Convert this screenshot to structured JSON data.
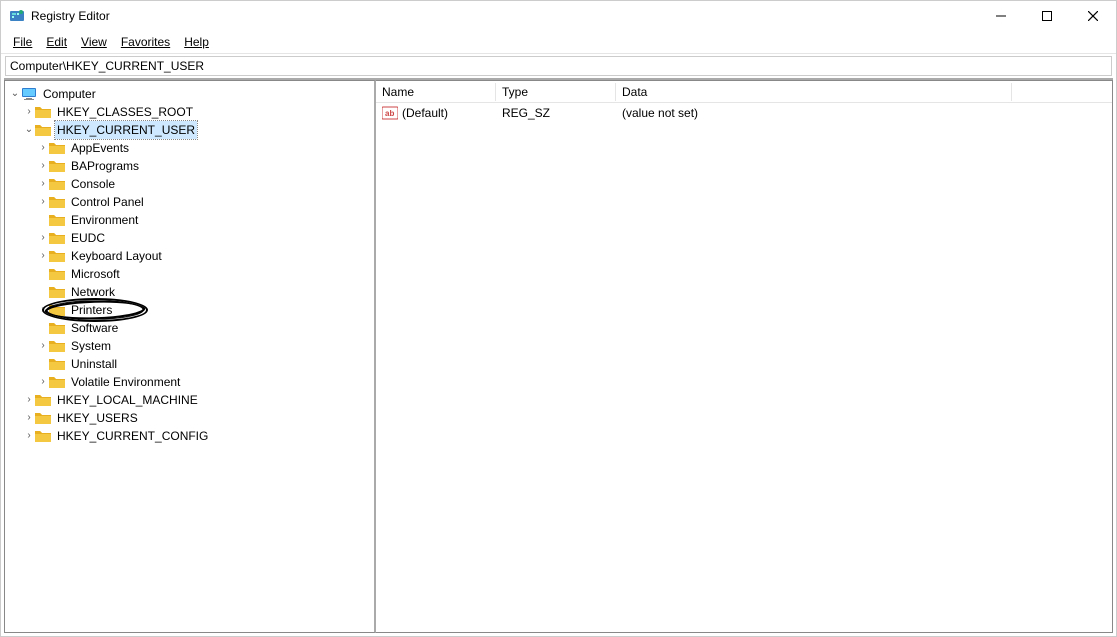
{
  "window": {
    "title": "Registry Editor"
  },
  "menu": {
    "file": "File",
    "edit": "Edit",
    "view": "View",
    "favorites": "Favorites",
    "help": "Help"
  },
  "address": "Computer\\HKEY_CURRENT_USER",
  "tree": {
    "root": "Computer",
    "hkcr": "HKEY_CLASSES_ROOT",
    "hkcu": "HKEY_CURRENT_USER",
    "hkcu_children": {
      "appevents": "AppEvents",
      "baprograms": "BAPrograms",
      "console": "Console",
      "controlpanel": "Control Panel",
      "environment": "Environment",
      "eudc": "EUDC",
      "keyboard": "Keyboard Layout",
      "microsoft": "Microsoft",
      "network": "Network",
      "printers": "Printers",
      "software": "Software",
      "system": "System",
      "uninstall": "Uninstall",
      "volatile": "Volatile Environment"
    },
    "hklm": "HKEY_LOCAL_MACHINE",
    "hku": "HKEY_USERS",
    "hkcc": "HKEY_CURRENT_CONFIG"
  },
  "list": {
    "headers": {
      "name": "Name",
      "type": "Type",
      "data": "Data"
    },
    "rows": [
      {
        "name": "(Default)",
        "type": "REG_SZ",
        "data": "(value not set)"
      }
    ]
  }
}
